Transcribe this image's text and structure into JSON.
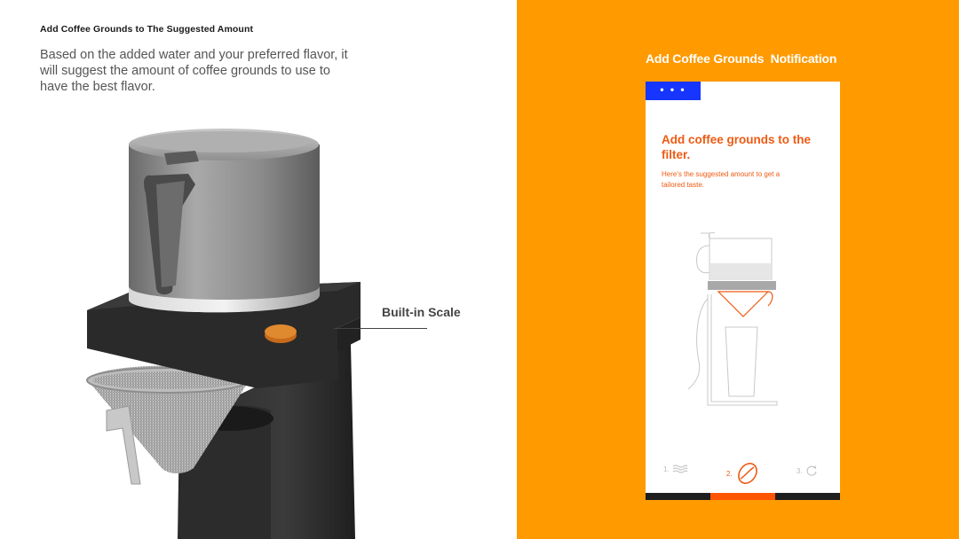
{
  "left": {
    "heading": "Add Coffee Grounds to The Suggested Amount",
    "description": "Based on the added water and your preferred flavor, it will suggest the amount of coffee grounds to use to have the best flavor.",
    "callout_label": "Built-in Scale"
  },
  "right": {
    "title": "Add Coffee Grounds  Notification",
    "menu_label": "• • •",
    "phone_heading": "Add coffee grounds to the filter.",
    "phone_sub": "Here's the suggested amount to get a tailored taste.",
    "steps": [
      {
        "number": "1.",
        "icon": "water-waves-icon",
        "active": false
      },
      {
        "number": "2.",
        "icon": "coffee-bean-icon",
        "active": true
      },
      {
        "number": "3.",
        "icon": "refresh-icon",
        "active": false
      }
    ],
    "progress_active_step": 2
  },
  "colors": {
    "accent_orange": "#ff9a00",
    "text_orange": "#ee5a12",
    "menu_blue": "#1636ff",
    "progress_active": "#ff5500",
    "progress_inactive": "#1e1e1e"
  }
}
